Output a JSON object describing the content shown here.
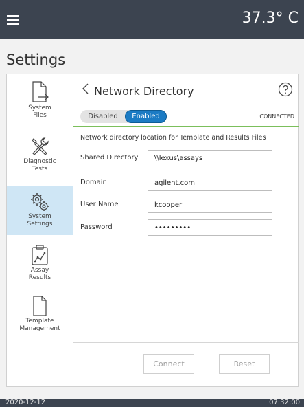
{
  "header": {
    "temperature": "37.3° C",
    "menu_icon": "hamburger-icon"
  },
  "page": {
    "title": "Settings"
  },
  "sidebar": {
    "items": [
      {
        "label_line1": "System",
        "label_line2": "Files",
        "icon": "file-export-icon",
        "active": false
      },
      {
        "label_line1": "Diagnostic",
        "label_line2": "Tests",
        "icon": "tools-icon",
        "active": false
      },
      {
        "label_line1": "System",
        "label_line2": "Settings",
        "icon": "gears-icon",
        "active": true
      },
      {
        "label_line1": "Assay",
        "label_line2": "Results",
        "icon": "chart-clipboard-icon",
        "active": false
      },
      {
        "label_line1": "Template",
        "label_line2": "Management",
        "icon": "document-icon",
        "active": false
      }
    ]
  },
  "content": {
    "title": "Network Directory",
    "toggle": {
      "off_label": "Disabled",
      "on_label": "Enabled",
      "selected": "Enabled"
    },
    "status": "CONNECTED",
    "description": "Network directory location for Template and Results Files",
    "fields": [
      {
        "label": "Shared Directory",
        "value": "\\\\lexus\\assays"
      },
      {
        "label": "Domain",
        "value": "agilent.com"
      },
      {
        "label": "User Name",
        "value": "kcooper"
      },
      {
        "label": "Password",
        "value": "•••••••••"
      }
    ],
    "buttons": {
      "connect": "Connect",
      "reset": "Reset"
    }
  },
  "colors": {
    "topbar": "#3c4450",
    "accent": "#1b7bc4",
    "active_nav": "#cfe6f5",
    "status_line": "#7bbf5b"
  },
  "footer": {
    "date": "2020-12-12",
    "time": "07:32:00"
  }
}
